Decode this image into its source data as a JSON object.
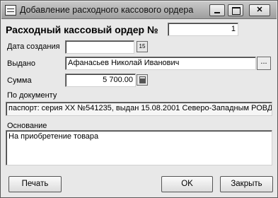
{
  "window": {
    "title": "Добавление расходного кассового ордера",
    "controls": {
      "minimize": "",
      "maximize": "",
      "close": "✕"
    }
  },
  "form": {
    "order_label": "Расходный кассовый ордер №",
    "order_number": "1",
    "date_label": "Дата создания",
    "date_value": "",
    "date_button": "15",
    "issued_label": "Выдано",
    "issued_value": "Афанасьев Николай Иванович",
    "issued_button": "...",
    "amount_label": "Сумма",
    "amount_value": "5 700.00",
    "document_label": "По документу",
    "document_value": "паспорт: серия XX №541235, выдан 15.08.2001 Северо-Западным РОВД",
    "basis_label": "Основание",
    "basis_value": "На приобретение товара"
  },
  "buttons": {
    "print": "Печать",
    "ok": "OK",
    "close": "Закрыть"
  }
}
